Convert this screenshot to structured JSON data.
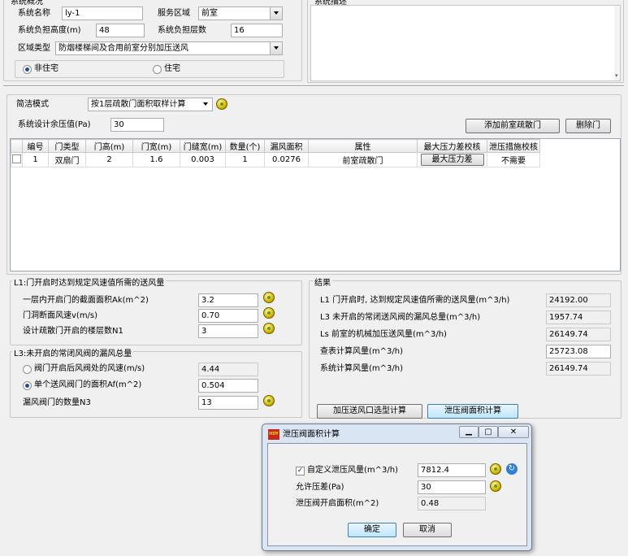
{
  "system_overview": {
    "title": "系统概况",
    "system_name_label": "系统名称",
    "system_name_value": "ly-1",
    "service_area_label": "服务区域",
    "service_area_value": "前室",
    "height_label": "系统负担高度(m)",
    "height_value": "48",
    "floors_label": "系统负担层数",
    "floors_value": "16",
    "zone_type_label": "区域类型",
    "zone_type_value": "防烟楼梯间及合用前室分别加压送风",
    "radio_nonresidential": "非住宅",
    "radio_residential": "住宅"
  },
  "system_description": {
    "title": "系统描述"
  },
  "calc": {
    "mode_label": "简洁模式",
    "mode_value": "按1层疏散门面积取样计算",
    "pressure_label": "系统设计余压值(Pa)",
    "pressure_value": "30",
    "add_door_button": "添加前室疏散门",
    "delete_door_button": "删除门"
  },
  "door_table": {
    "columns": [
      "编号",
      "门类型",
      "门高(m)",
      "门宽(m)",
      "门缝宽(m)",
      "数量(个)",
      "漏风面积",
      "属性",
      "最大压力差校核",
      "泄压措施校核"
    ],
    "rows": [
      {
        "id": "1",
        "type": "双扇门",
        "height": "2",
        "width": "1.6",
        "gap": "0.003",
        "count": "1",
        "leak_area": "0.0276",
        "attr": "前室疏散门",
        "max_pressure_button": "最大压力差",
        "relief": "不需要"
      }
    ]
  },
  "l1": {
    "title": "L1:门开启时达到规定风速值所需的送风量",
    "area_label": "一层内开启门的截面面积Ak(m^2)",
    "area_value": "3.2",
    "velocity_label": "门洞断面风速v(m/s)",
    "velocity_value": "0.70",
    "floors_label": "设计疏散门开启的楼层数N1",
    "floors_value": "3"
  },
  "l3": {
    "title": "L3:未开启的常闭风阀的漏风总量",
    "radio1_label": "阀门开启后风阀处的风速(m/s)",
    "radio1_value": "4.44",
    "radio2_label": "单个送风阀门的面积Af(m^2)",
    "radio2_value": "0.504",
    "count_label": "漏风阀门的数量N3",
    "count_value": "13"
  },
  "results": {
    "title": "结果",
    "rows": [
      {
        "label": "L1 门开启时, 达到规定风速值所需的送风量(m^3/h)",
        "value": "24192.00"
      },
      {
        "label": "L3 未开启的常闭送风阀的漏风总量(m^3/h)",
        "value": "1957.74"
      },
      {
        "label": "Ls 前室的机械加压送风量(m^3/h)",
        "value": "26149.74"
      },
      {
        "label": "查表计算风量(m^3/h)",
        "value": "25723.08"
      },
      {
        "label": "系统计算风量(m^3/h)",
        "value": "26149.74"
      }
    ],
    "outlet_button": "加压送风口选型计算",
    "relief_button": "泄压阀面积计算"
  },
  "dialog": {
    "icon_text": "HDY",
    "title": "泄压阀面积计算",
    "custom_label": "自定义泄压风量(m^3/h)",
    "custom_value": "7812.4",
    "allowed_label": "允许压差(Pa)",
    "allowed_value": "30",
    "area_label": "泄压阀开启面积(m^2)",
    "area_value": "0.48",
    "ok_button": "确定",
    "cancel_button": "取消"
  }
}
